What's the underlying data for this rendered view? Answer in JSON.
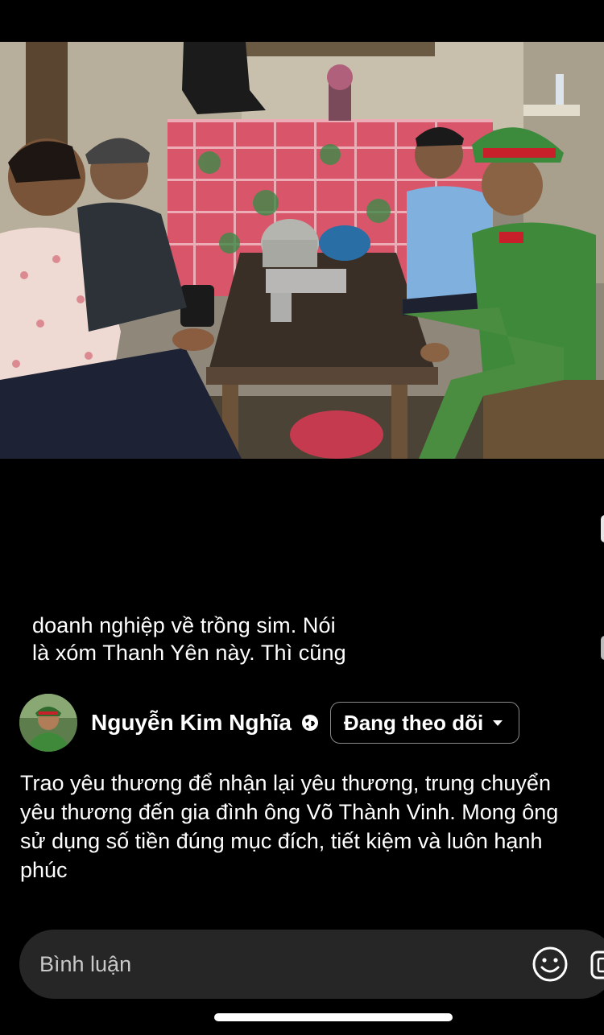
{
  "caption": {
    "line1": "doanh nghiệp về trồng sim. Nói",
    "line2": "là xóm Thanh Yên này. Thì cũng"
  },
  "author": {
    "name": "Nguyễn Kim Nghĩa",
    "follow_label": "Đang theo dõi",
    "audience_icon": "globe-icon"
  },
  "description": "Trao yêu thương để nhận lại yêu thương, trung chuyển yêu thương đến gia đình ông Võ Thành Vinh. Mong ông sử dụng số tiền đúng mục đích, tiết kiệm và luôn hạnh phúc",
  "comment": {
    "placeholder": "Bình luận",
    "emoji_icon": "smiley-icon",
    "extra_icon": "gift-icon"
  },
  "colors": {
    "background": "#000000",
    "comment_bar": "#262626",
    "uniform_green": "#3f8a3a",
    "uniform_red": "#c8202a"
  }
}
